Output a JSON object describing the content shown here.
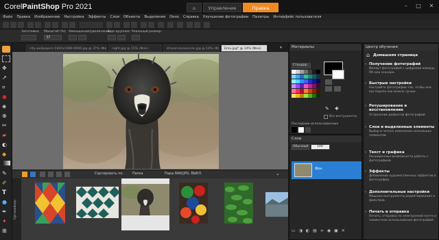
{
  "app": {
    "brand_corel": "Corel",
    "brand_name": "PaintShop",
    "brand_pro": "Pro 2021"
  },
  "workspace_tabs": {
    "home_icon": "home-icon",
    "manage": "Управление",
    "edit": "Правка"
  },
  "menu": [
    "Файл",
    "Правка",
    "Изображение",
    "Настройка",
    "Эффекты",
    "Слои",
    "Объекты",
    "Выделения",
    "Окно",
    "Справка",
    "Улучшение фотографии",
    "Палитры",
    "Интерфейс пользователя"
  ],
  "options": {
    "presets": "Заготовки:",
    "zoom_label": "Масштаб (%):",
    "zoom_value": "37",
    "zoom_out_more": "Уменьшение/увеличение:",
    "zoom_more": "Еще крупнее:",
    "actual_size": "Реальный размер:"
  },
  "doc_tabs": [
    "city-wallpapers-1920x1080-0006.jpg @ 37% (Фон)",
    "night.jpg @ 15% (Фон)",
    "strand-ressources.jpg @ 14% (Фон)",
    "Emu.jpg* @ 14% (Фон)"
  ],
  "organizer": {
    "sort_by": "Сортировать по:",
    "folder": "Папка",
    "raw_pairs": "Пары RAW/JPG: ВЫКЛ.",
    "side_label": "Органайзер"
  },
  "materials": {
    "title": "Материалы",
    "mode": "Стандар...",
    "all_tools": "Все инструменты",
    "recent": "Последние использованные"
  },
  "layers": {
    "title": "Слои",
    "blend": "Обычный",
    "opacity": "100",
    "layer_name": "Фон"
  },
  "learning": {
    "title": "Центр обучения",
    "home": "Домашняя страница",
    "items": [
      {
        "title": "Получение фотографий",
        "desc": "Импорт фотографий с цифровой камеры, ПК или сканера."
      },
      {
        "title": "Быстрые настройки",
        "desc": "Настройте фотографии так, чтобы они выглядели как можно лучше."
      },
      {
        "title": "Ретуширование и восстановление",
        "desc": "Устранение дефектов фотографий."
      },
      {
        "title": "Слои и выделенные элементы",
        "desc": "Выбор и четкое изменение нескольких элементов."
      },
      {
        "title": "Текст и графика",
        "desc": "Расширенные возможности работы с фотографией."
      },
      {
        "title": "Эффекты",
        "desc": "Добавление художественных эффектов в фотографии."
      },
      {
        "title": "Дополнительные настройки",
        "desc": "Мощные инструменты редактирования и фильтров."
      },
      {
        "title": "Печать и отправка",
        "desc": "Печать, отправка по электронной почте и совместное использование фотографий."
      }
    ]
  },
  "colors": {
    "accent_orange": "#f08a24",
    "selection_blue": "#2a7fd4"
  }
}
